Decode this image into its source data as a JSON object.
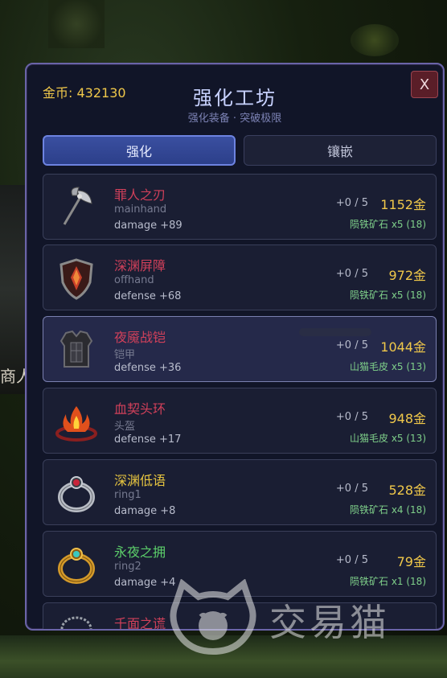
{
  "background": {
    "left_text": "商人"
  },
  "header": {
    "gold": "金币: 432130",
    "title": "强化工坊",
    "subtitle": "强化装备 · 突破极限",
    "close_label": "X"
  },
  "tabs": [
    {
      "label": "强化",
      "active": true
    },
    {
      "label": "镶嵌",
      "active": false
    }
  ],
  "items": [
    {
      "name": "罪人之刃",
      "name_color": "#d0405a",
      "slot": "mainhand",
      "stat": "damage +89",
      "level": "+0 / 5",
      "cost": "1152金",
      "material": "陨铁矿石 x5 (18)",
      "icon": "battle-axe-icon"
    },
    {
      "name": "深渊屏障",
      "name_color": "#d0405a",
      "slot": "offhand",
      "stat": "defense +68",
      "level": "+0 / 5",
      "cost": "972金",
      "material": "陨铁矿石 x5 (18)",
      "icon": "shield-icon"
    },
    {
      "name": "夜魇战铠",
      "name_color": "#d0405a",
      "slot": "铠甲",
      "stat": "defense +36",
      "level": "+0 / 5",
      "cost": "1044金",
      "material": "山猫毛皮 x5 (13)",
      "icon": "armor-icon",
      "selected": true
    },
    {
      "name": "血契头环",
      "name_color": "#d0405a",
      "slot": "头盔",
      "stat": "defense +17",
      "level": "+0 / 5",
      "cost": "948金",
      "material": "山猫毛皮 x5 (13)",
      "icon": "flame-circlet-icon"
    },
    {
      "name": "深渊低语",
      "name_color": "#e8c640",
      "slot": "ring1",
      "stat": "damage +8",
      "level": "+0 / 5",
      "cost": "528金",
      "material": "陨铁矿石 x4 (18)",
      "icon": "silver-ring-icon"
    },
    {
      "name": "永夜之拥",
      "name_color": "#5ccf6a",
      "slot": "ring2",
      "stat": "damage +4",
      "level": "+0 / 5",
      "cost": "79金",
      "material": "陨铁矿石 x1 (18)",
      "icon": "gold-ring-icon"
    },
    {
      "name": "千面之谎",
      "name_color": "#d0405a",
      "slot": "",
      "stat": "",
      "level": "",
      "cost": "",
      "material": "",
      "icon": "necklace-icon"
    }
  ],
  "watermark": {
    "text": "交易猫"
  }
}
